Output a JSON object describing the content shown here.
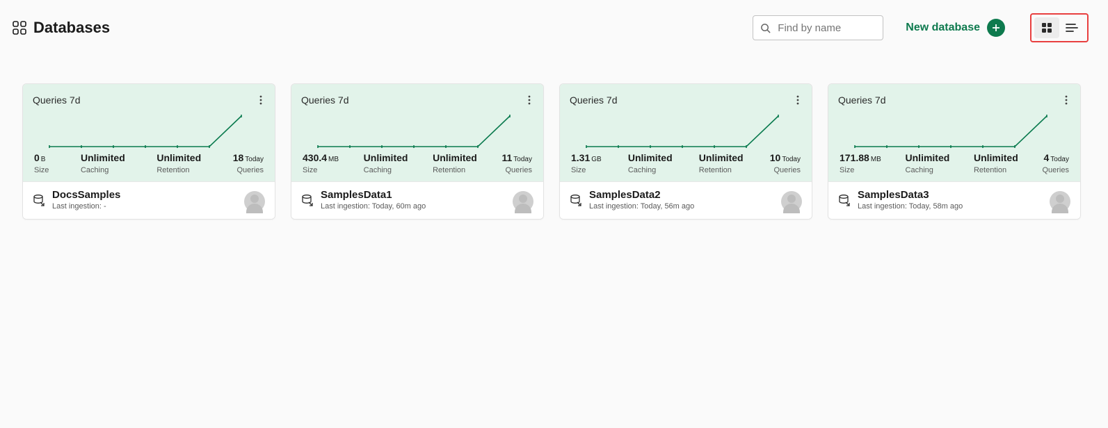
{
  "header": {
    "title": "Databases",
    "search_placeholder": "Find by name",
    "new_db_label": "New database"
  },
  "queries_label": "Queries 7d",
  "stat_labels": {
    "size": "Size",
    "caching": "Caching",
    "retention": "Retention",
    "queries": "Queries"
  },
  "chart_data": [
    {
      "type": "line",
      "title": "Queries 7d",
      "x": [
        0,
        1,
        2,
        3,
        4,
        5,
        6
      ],
      "values": [
        10,
        10,
        10,
        10,
        10,
        10,
        30
      ],
      "ylabel": "",
      "xlabel": ""
    },
    {
      "type": "line",
      "title": "Queries 7d",
      "x": [
        0,
        1,
        2,
        3,
        4,
        5,
        6
      ],
      "values": [
        10,
        10,
        10,
        10,
        10,
        10,
        30
      ],
      "ylabel": "",
      "xlabel": ""
    },
    {
      "type": "line",
      "title": "Queries 7d",
      "x": [
        0,
        1,
        2,
        3,
        4,
        5,
        6
      ],
      "values": [
        10,
        10,
        10,
        10,
        10,
        10,
        30
      ],
      "ylabel": "",
      "xlabel": ""
    },
    {
      "type": "line",
      "title": "Queries 7d",
      "x": [
        0,
        1,
        2,
        3,
        4,
        5,
        6
      ],
      "values": [
        10,
        10,
        10,
        10,
        10,
        10,
        30
      ],
      "ylabel": "",
      "xlabel": ""
    }
  ],
  "cards": [
    {
      "size_val": "0",
      "size_unit": "B",
      "caching": "Unlimited",
      "retention": "Unlimited",
      "queries_val": "18",
      "queries_unit": "Today",
      "name": "DocsSamples",
      "ingestion": "Last ingestion: -"
    },
    {
      "size_val": "430.4",
      "size_unit": "MB",
      "caching": "Unlimited",
      "retention": "Unlimited",
      "queries_val": "11",
      "queries_unit": "Today",
      "name": "SamplesData1",
      "ingestion": "Last ingestion: Today, 60m ago"
    },
    {
      "size_val": "1.31",
      "size_unit": "GB",
      "caching": "Unlimited",
      "retention": "Unlimited",
      "queries_val": "10",
      "queries_unit": "Today",
      "name": "SamplesData2",
      "ingestion": "Last ingestion: Today, 56m ago"
    },
    {
      "size_val": "171.88",
      "size_unit": "MB",
      "caching": "Unlimited",
      "retention": "Unlimited",
      "queries_val": "4",
      "queries_unit": "Today",
      "name": "SamplesData3",
      "ingestion": "Last ingestion: Today, 58m ago"
    }
  ]
}
